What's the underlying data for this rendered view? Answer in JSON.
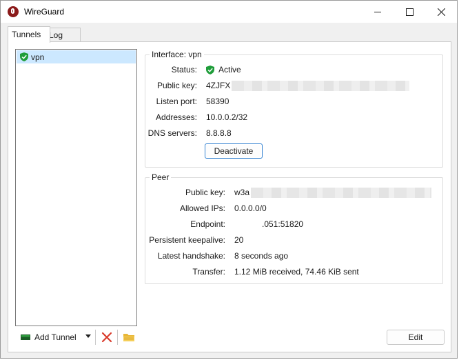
{
  "window": {
    "title": "WireGuard"
  },
  "tabs": [
    {
      "label": "Tunnels",
      "active": true
    },
    {
      "label": "Log",
      "active": false
    }
  ],
  "tunnels": [
    {
      "name": "vpn",
      "status_icon": "shield-check-icon",
      "selected": true
    }
  ],
  "toolbar": {
    "add_tunnel_label": "Add Tunnel",
    "add_icon": "add-tunnel-icon",
    "dropdown_icon": "chevron-down-icon",
    "delete_icon": "delete-x-icon",
    "import_icon": "folder-icon"
  },
  "interface": {
    "title": "Interface: vpn",
    "status_label": "Status:",
    "status_value": "Active",
    "public_key_label": "Public key:",
    "public_key_value": "4ZJFX",
    "listen_port_label": "Listen port:",
    "listen_port_value": "58390",
    "addresses_label": "Addresses:",
    "addresses_value": "10.0.0.2/32",
    "dns_label": "DNS servers:",
    "dns_value": "8.8.8.8",
    "deactivate_label": "Deactivate"
  },
  "peer": {
    "title": "Peer",
    "public_key_label": "Public key:",
    "public_key_value": "w3a",
    "allowed_ips_label": "Allowed IPs:",
    "allowed_ips_value": "0.0.0.0/0",
    "endpoint_label": "Endpoint:",
    "endpoint_value": ".051:51820",
    "keepalive_label": "Persistent keepalive:",
    "keepalive_value": "20",
    "handshake_label": "Latest handshake:",
    "handshake_value": "8 seconds ago",
    "transfer_label": "Transfer:",
    "transfer_value": "1.12 MiB received, 74.46 KiB sent"
  },
  "edit_label": "Edit",
  "colors": {
    "accent": "#2f7fd0",
    "selection": "#cce8ff",
    "active_green": "#1f9d3a",
    "delete_red": "#d93a2b"
  }
}
